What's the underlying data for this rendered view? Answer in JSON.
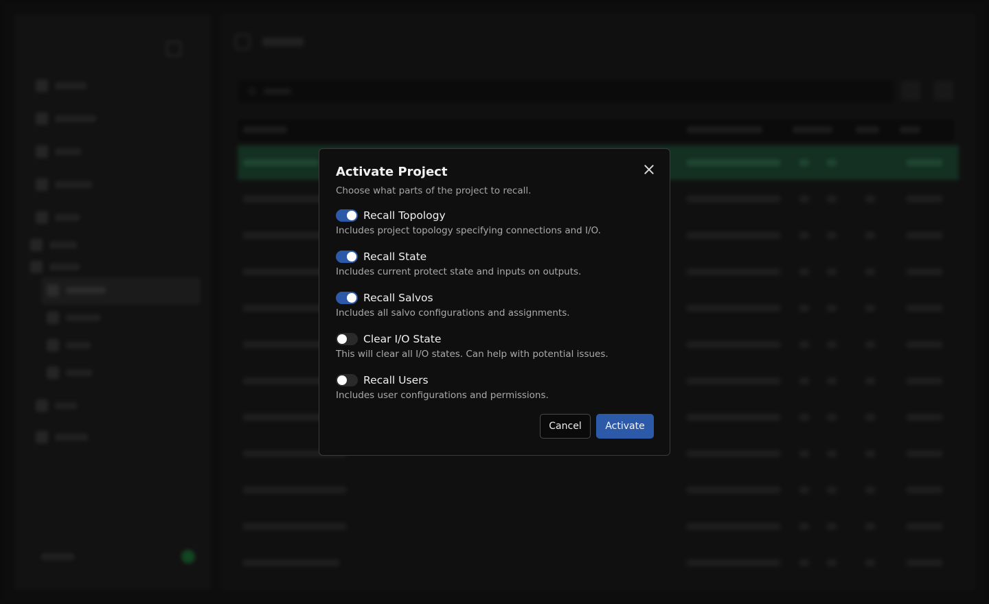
{
  "modal": {
    "title": "Activate Project",
    "subtitle": "Choose what parts of the project to recall.",
    "options": [
      {
        "label": "Recall Topology",
        "description": "Includes project topology specifying connections and I/O.",
        "enabled": true
      },
      {
        "label": "Recall State",
        "description": "Includes current protect state and inputs on outputs.",
        "enabled": true
      },
      {
        "label": "Recall Salvos",
        "description": "Includes all salvo configurations and assignments.",
        "enabled": true
      },
      {
        "label": "Clear I/O State",
        "description": "This will clear all I/O states. Can help with potential issues.",
        "enabled": false
      },
      {
        "label": "Recall Users",
        "description": "Includes user configurations and permissions.",
        "enabled": false
      }
    ],
    "cancel_label": "Cancel",
    "activate_label": "Activate"
  },
  "colors": {
    "accent": "#2c5aa8",
    "modal_background": "#0f0f0f",
    "active_row": "#1f4a35",
    "status_online": "#1c6b33"
  }
}
